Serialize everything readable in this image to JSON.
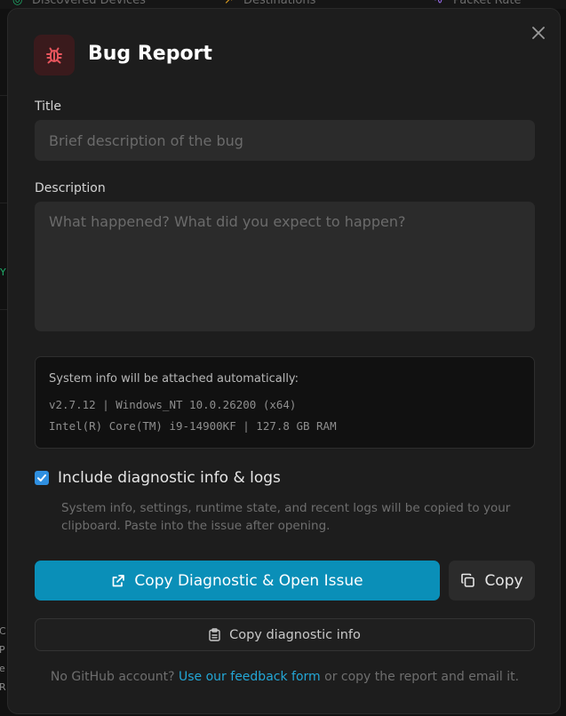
{
  "background": {
    "tabs": [
      "Discovered Devices",
      "Destinations",
      "Packet Rate"
    ],
    "left_fragments": [
      "C",
      "P",
      "e",
      "R"
    ],
    "y_fragment": "Y"
  },
  "modal": {
    "title": "Bug Report",
    "icon": "bug-icon",
    "close_icon": "close-icon",
    "title_field": {
      "label": "Title",
      "placeholder": "Brief description of the bug",
      "value": ""
    },
    "description_field": {
      "label": "Description",
      "placeholder": "What happened? What did you expect to happen?",
      "value": ""
    },
    "system_info": {
      "heading": "System info will be attached automatically:",
      "line1": "v2.7.12 | Windows_NT 10.0.26200 (x64)",
      "line2": "Intel(R) Core(TM) i9-14900KF | 127.8 GB RAM"
    },
    "diagnostics": {
      "checked": true,
      "label": "Include diagnostic info & logs",
      "help": "System info, settings, runtime state, and recent logs will be copied to your clipboard. Paste into the issue after opening."
    },
    "buttons": {
      "primary": "Copy Diagnostic & Open Issue",
      "copy": "Copy",
      "copy_diagnostic": "Copy diagnostic info"
    },
    "footer": {
      "prefix": "No GitHub account?",
      "link": "Use our feedback form",
      "suffix": "or copy the report and email it."
    },
    "colors": {
      "accent": "#0a8fb8",
      "link": "#23a6d5",
      "checkbox": "#2f8fe0",
      "bug_icon": "#e8555d"
    }
  }
}
